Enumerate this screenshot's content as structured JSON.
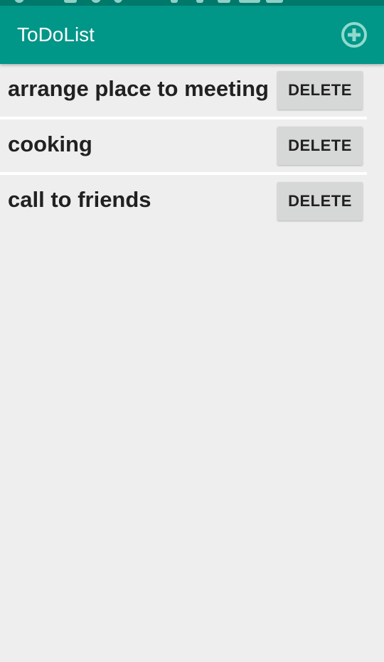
{
  "app": {
    "title": "ToDoList",
    "add_icon": "plus-circle-icon"
  },
  "colors": {
    "status_bar": "#00796b",
    "app_bar": "#009688",
    "background": "#eeeeee",
    "delete_button": "#d6d7d7"
  },
  "todo_items": [
    {
      "text": "arrange place to meeting",
      "delete_label": "DELETE"
    },
    {
      "text": "cooking",
      "delete_label": "DELETE"
    },
    {
      "text": "call to friends",
      "delete_label": "DELETE"
    }
  ]
}
